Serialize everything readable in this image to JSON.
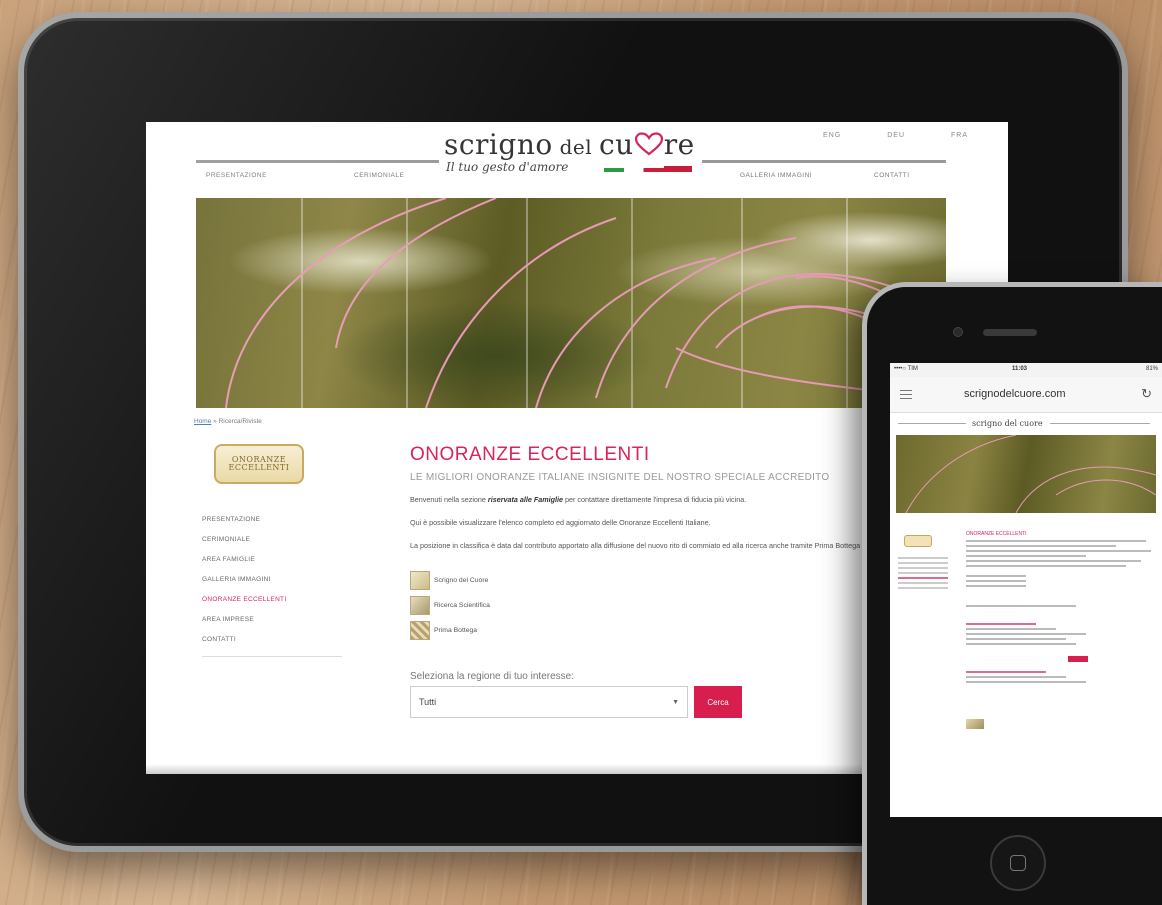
{
  "site": {
    "lang": [
      "ENG",
      "DEU",
      "FRA"
    ],
    "logo_title_1": "scrigno",
    "logo_title_2": " del ",
    "logo_title_3": "cu",
    "logo_title_4": "re",
    "logo_subtitle": "Il tuo gesto d'amore",
    "nav": [
      "PRESENTAZIONE",
      "CERIMONIALE",
      "GALLERIA IMMAGINI",
      "CONTATTI"
    ]
  },
  "breadcrumb": {
    "home": "Home",
    "separator": " » ",
    "current": "Ricerca/Riviste"
  },
  "sidebar": {
    "logo_line1": "ONORANZE",
    "logo_line2": "ECCELLENTI",
    "items": [
      "PRESENTAZIONE",
      "CERIMONIALE",
      "AREA FAMIGLIE",
      "GALLERIA IMMAGINI",
      "ONORANZE ECCELLENTI",
      "AREA IMPRESE",
      "CONTATTI"
    ],
    "active_index": 4
  },
  "main": {
    "title": "ONORANZE ECCELLENTI",
    "subtitle": "LE MIGLIORI ONORANZE ITALIANE INSIGNITE DEL NOSTRO SPECIALE ACCREDITO",
    "para1_pre": "Benvenuti nella sezione ",
    "para1_bold": "riservata alle Famiglie",
    "para1_post": " per contattare direttamente l'impresa di fiducia più vicina.",
    "para2": "Qui è possibile visualizzare l'elenco completo ed aggiornato delle Onoranze Eccellenti Italiane.",
    "para3": "La posizione in classifica è data dal contributo apportato alla diffusione del nuovo rito di commiato ed alla ricerca anche tramite Prima Bottega Ebanisteria Italiana.",
    "legend": [
      "Scrigno del Cuore",
      "Ricerca Scientifica",
      "Prima Bottega"
    ],
    "select_label": "Seleziona la regione di tuo interesse:",
    "select_value": "Tutti",
    "search_button": "Cerca"
  },
  "phone": {
    "carrier": "••••○ TIM ",
    "time": "11:03",
    "battery": "81%",
    "url": "scrignodelcuore.com",
    "site_title": "scrigno del cuore",
    "section_title": "ONORANZE ECCELLENTI"
  },
  "colors": {
    "accent": "#d8245b",
    "button": "#d81e4d",
    "flag_green": "#2b9a43",
    "flag_red": "#cc1e37"
  },
  "icons": [
    "heart-icon",
    "chevron-down-icon",
    "menu-icon",
    "reload-icon",
    "home-button-icon"
  ]
}
